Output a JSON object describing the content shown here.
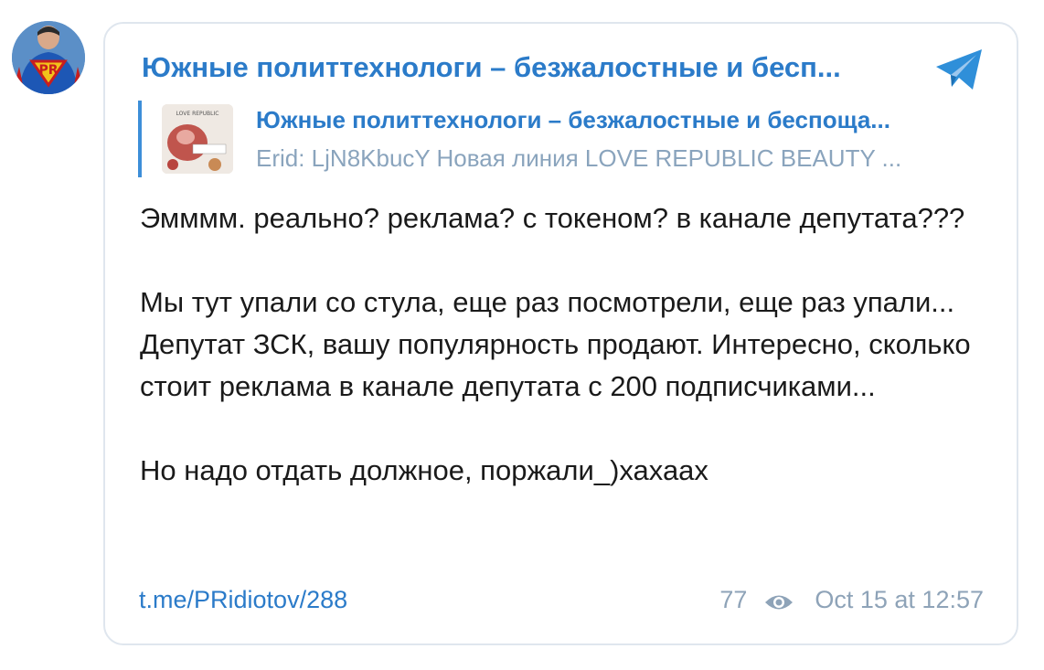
{
  "post": {
    "channel_title": "Южные политтехнологи – безжалостные и бесп...",
    "quote": {
      "title": "Южные политтехнологи – безжалостные и беспоща...",
      "text": "Erid: LjN8KbucY Новая линия LOVE REPUBLIC BEAUTY ..."
    },
    "paragraphs": [
      "Эмммм. реально? реклама? с токеном? в канале депутата???",
      "Мы тут упали со стула, еще раз посмотрели, еще раз упали... Депутат ЗСК, вашу популярность продают. Интересно, сколько стоит реклама в канале депутата с 200 подписчиками...",
      "Но надо отдать должное, поржали_)хахаах"
    ],
    "link": "t.me/PRidiotov/288",
    "views": "77",
    "timestamp": "Oct 15 at 12:57"
  },
  "icons": {
    "share": "telegram-paper-plane-icon",
    "views": "eye-icon"
  },
  "colors": {
    "accent": "#2b7bc9",
    "muted": "#8ea3b8",
    "quote_bar": "#3d8ed8"
  }
}
